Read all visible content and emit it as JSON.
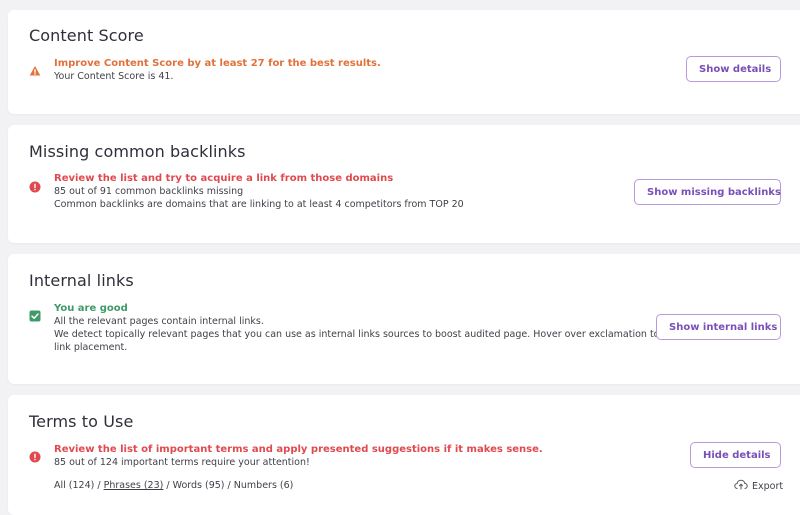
{
  "content_score": {
    "title": "Content Score",
    "message_title": "Improve Content Score by at least 27 for the best results.",
    "message_line": "Your Content Score is 41.",
    "button": "Show details"
  },
  "backlinks": {
    "title": "Missing common backlinks",
    "message_title": "Review the list and try to acquire a link from those domains",
    "line1": "85 out of 91 common backlinks missing",
    "line2": "Common backlinks are domains that are linking to at least 4 competitors from TOP 20",
    "button": "Show missing backlinks"
  },
  "internal_links": {
    "title": "Internal links",
    "message_title": "You are good",
    "line1": "All the relevant pages contain internal links.",
    "line2": "We detect topically relevant pages that you can use as internal links sources to boost audited page. Hover over exclamation to find the best",
    "line3": "link placement.",
    "button": "Show internal links"
  },
  "terms": {
    "title": "Terms to Use",
    "message_title": "Review the list of important terms and apply presented suggestions if it makes sense.",
    "line1": "85 out of 124 important terms require your attention!",
    "filters": {
      "all": "All (124)",
      "phrases": "Phrases (23)",
      "words": "Words (95)",
      "numbers": "Numbers (6)",
      "separator": "/"
    },
    "export": "Export",
    "button": "Hide details"
  },
  "colors": {
    "warning": "#e2713a",
    "error": "#e04a4f",
    "success": "#3f9a6a",
    "accent": "#7a4fb8"
  },
  "icons": {
    "content_score": "warning-triangle-icon",
    "backlinks": "error-circle-icon",
    "internal_links": "check-square-icon",
    "terms": "error-circle-icon",
    "export": "cloud-upload-icon"
  }
}
